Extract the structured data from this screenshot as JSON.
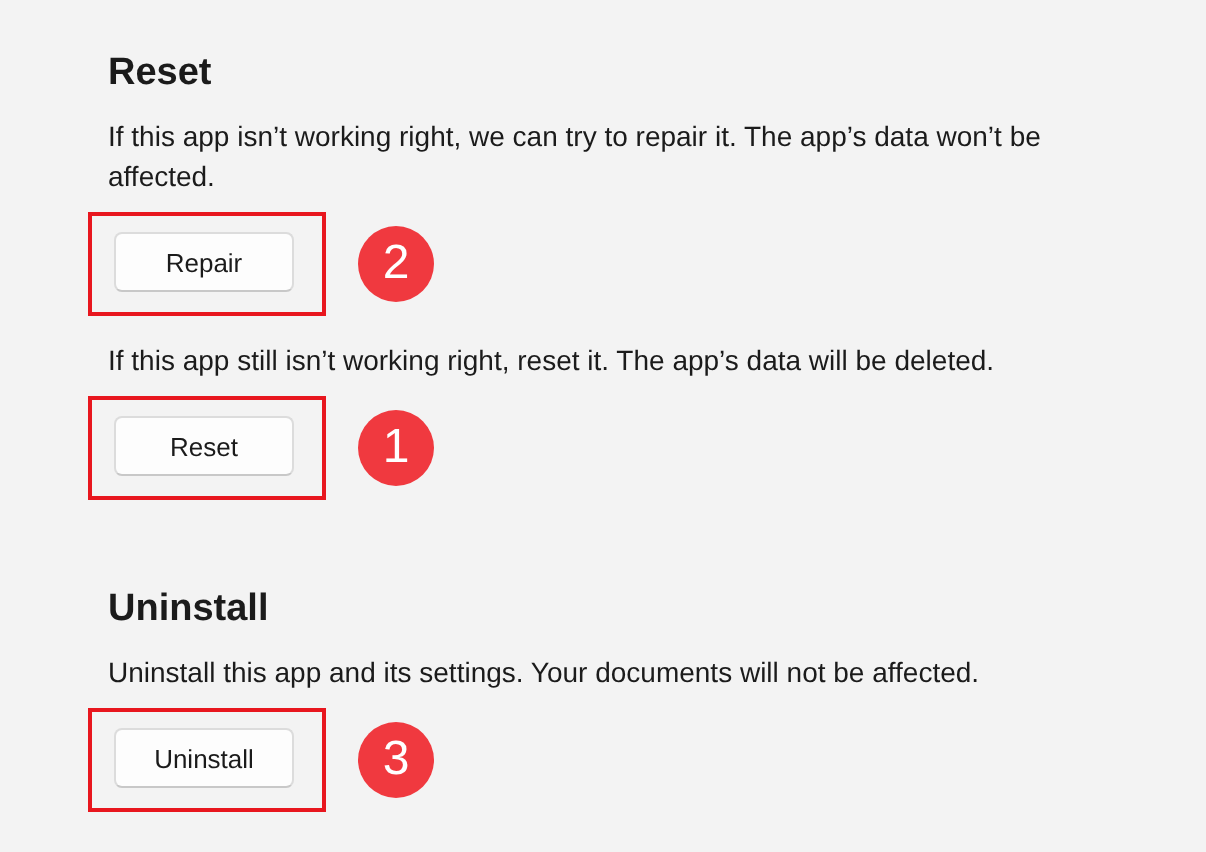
{
  "sections": [
    {
      "heading": "Reset",
      "items": [
        {
          "kind": "text",
          "text": "If this app isn’t working right, we can try to repair it. The app’s data won’t be affected."
        },
        {
          "kind": "button",
          "label": "Repair",
          "highlighted": true,
          "marker": "2"
        },
        {
          "kind": "text",
          "text": "If this app still isn’t working right, reset it. The app’s data will be deleted."
        },
        {
          "kind": "button",
          "label": "Reset",
          "highlighted": true,
          "marker": "1"
        }
      ]
    },
    {
      "heading": "Uninstall",
      "items": [
        {
          "kind": "text",
          "text": "Uninstall this app and its settings. Your documents will not be affected."
        },
        {
          "kind": "button",
          "label": "Uninstall",
          "highlighted": true,
          "marker": "3"
        }
      ]
    }
  ]
}
